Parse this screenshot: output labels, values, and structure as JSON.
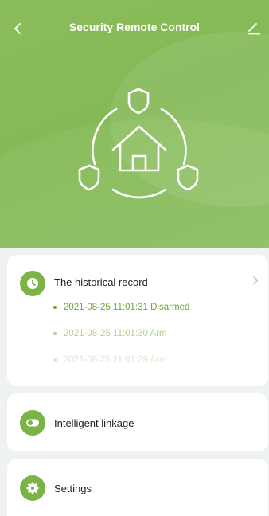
{
  "header": {
    "title": "Security Remote Control"
  },
  "illustration": {
    "icon": "home-security-icon"
  },
  "history": {
    "label": "The historical record",
    "records": [
      {
        "time": "2021-08-25 11:01:31",
        "status": "Disarmed",
        "text": "2021-08-25 11:01:31 Disarmed"
      },
      {
        "time": "2021-08-25 11:01:30",
        "status": "Arm",
        "text": "2021-08-25 11:01:30 Arm"
      },
      {
        "time": "2021-08-25 11:01:29",
        "status": "Arm",
        "text": "2021-08-25 11:01:29 Arm"
      }
    ]
  },
  "linkage": {
    "label": "Intelligent linkage",
    "icon": "toggle-icon"
  },
  "settings": {
    "label": "Settings",
    "icon": "gear-icon"
  },
  "colors": {
    "accent": "#7cb347",
    "hero": "#88bb59",
    "background": "#eef3f2"
  }
}
